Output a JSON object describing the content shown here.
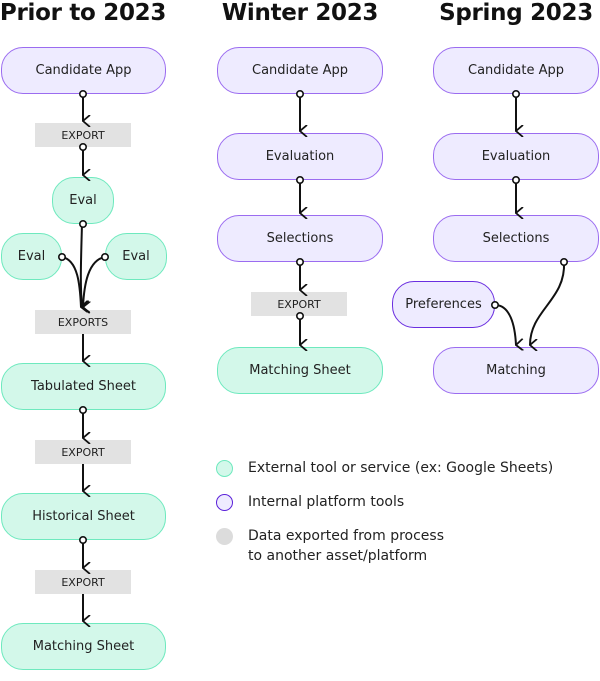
{
  "columns": [
    {
      "title": "Prior to 2023"
    },
    {
      "title": "Winter 2023"
    },
    {
      "title": "Spring 2023"
    }
  ],
  "prior": {
    "candidate_app": "Candidate App",
    "export1": "EXPORT",
    "eval_center": "Eval",
    "eval_left": "Eval",
    "eval_right": "Eval",
    "exports": "EXPORTS",
    "tabulated": "Tabulated Sheet",
    "export2": "EXPORT",
    "historical": "Historical Sheet",
    "export3": "EXPORT",
    "matching_sheet": "Matching Sheet"
  },
  "winter": {
    "candidate_app": "Candidate App",
    "evaluation": "Evaluation",
    "selections": "Selections",
    "export": "EXPORT",
    "matching_sheet": "Matching Sheet"
  },
  "spring": {
    "candidate_app": "Candidate App",
    "evaluation": "Evaluation",
    "selections": "Selections",
    "preferences": "Preferences",
    "matching": "Matching"
  },
  "legend": [
    {
      "label": "External tool or service (ex: Google Sheets)",
      "color": "#d3f8ea"
    },
    {
      "label": "Internal platform tools",
      "color": "#eeebff"
    },
    {
      "label": "Data exported from process",
      "label2": "to another asset/platform",
      "color": "#dcdcdc"
    }
  ]
}
